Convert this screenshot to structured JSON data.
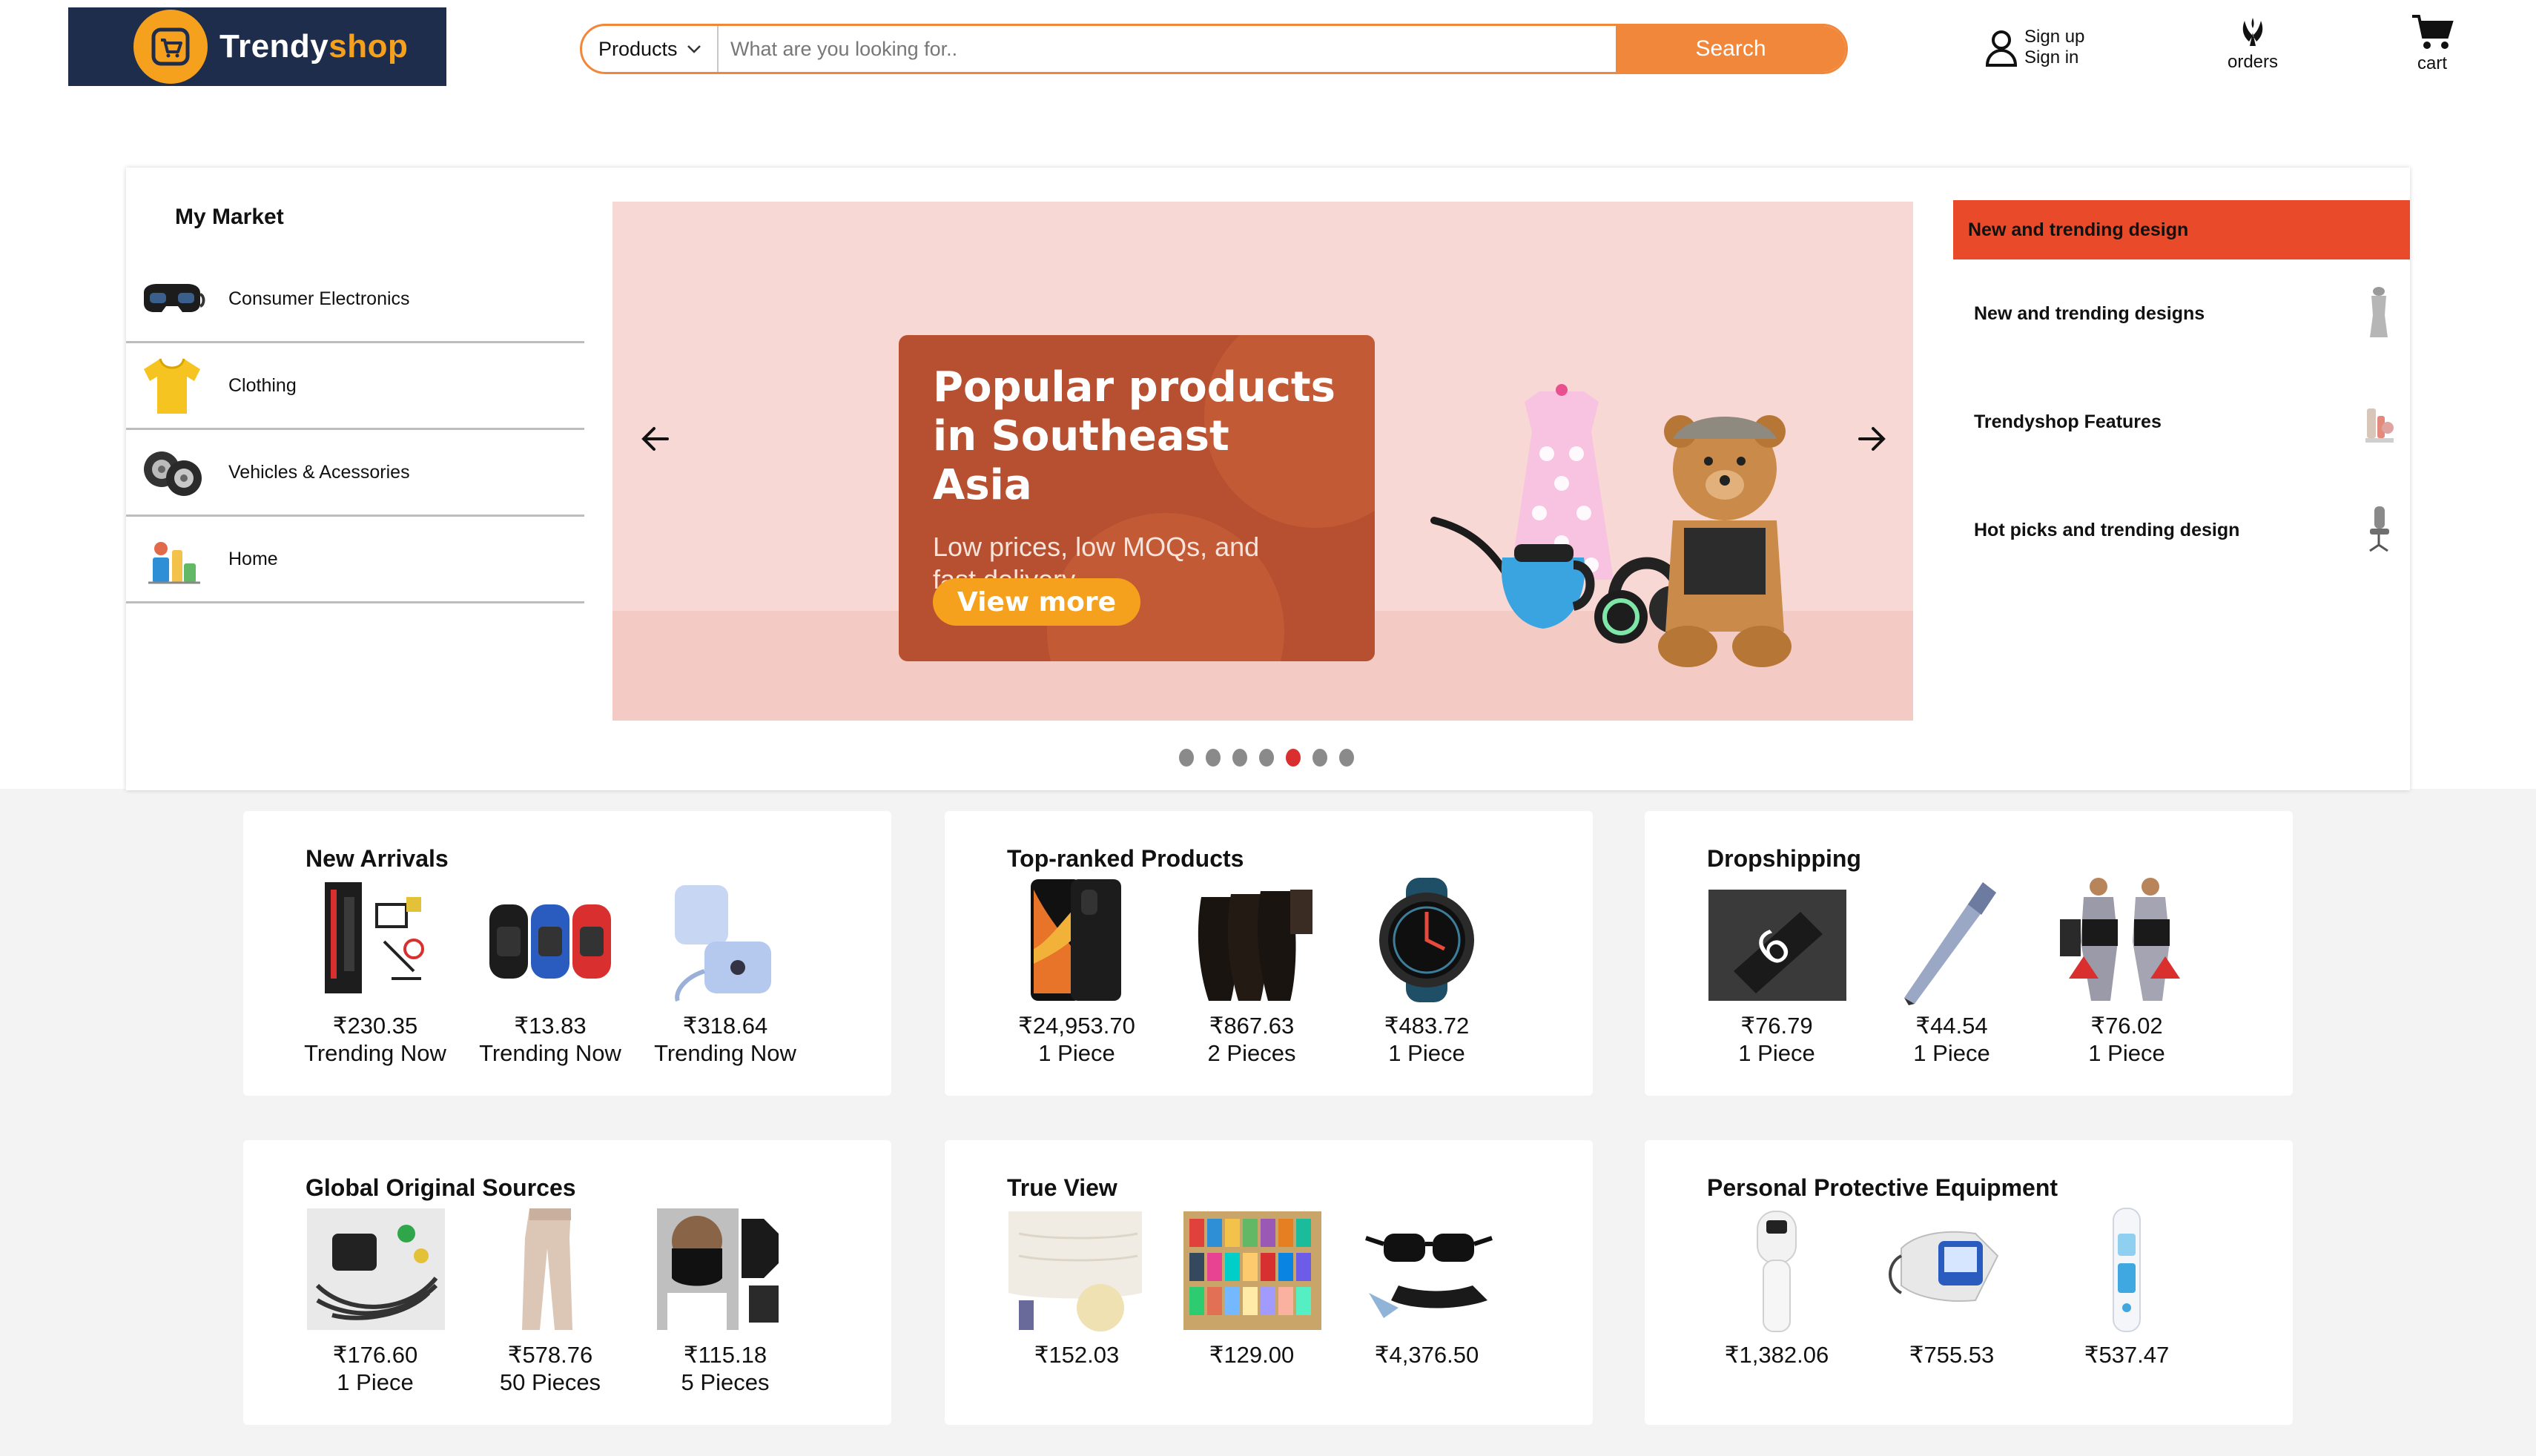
{
  "header": {
    "logo": {
      "brand_main": "Trendy",
      "brand_accent": "shop",
      "icon": "cart-logo-icon"
    },
    "search": {
      "category": "Products",
      "placeholder": "What are you looking for..",
      "button_label": "Search"
    },
    "account": {
      "sign_up": "Sign up",
      "sign_in": "Sign in",
      "icon": "user-icon"
    },
    "orders": {
      "label": "orders",
      "icon": "orders-icon"
    },
    "cart": {
      "label": "cart",
      "icon": "cart-icon"
    }
  },
  "market": {
    "title": "My Market",
    "items": [
      {
        "label": "Consumer Electronics",
        "icon": "vr-headset-icon"
      },
      {
        "label": "Clothing",
        "icon": "tshirt-icon"
      },
      {
        "label": "Vehicles & Acessories",
        "icon": "tire-icon"
      },
      {
        "label": "Home",
        "icon": "home-goods-icon"
      }
    ]
  },
  "banner": {
    "title_line1": "Popular products",
    "title_line2": "in Southeast Asia",
    "subtitle_line1": "Low prices, low MOQs, and",
    "subtitle_line2": "fast delivery",
    "cta": "View more",
    "slide_count": 7,
    "active_slide": 5
  },
  "trending": {
    "header": "New and trending design",
    "items": [
      {
        "label": "New and trending designs",
        "icon": "mannequin-icon"
      },
      {
        "label": "Trendyshop Features",
        "icon": "cosmetics-icon"
      },
      {
        "label": "Hot picks and trending design",
        "icon": "office-chair-icon"
      }
    ]
  },
  "colors": {
    "accent": "#f0873a",
    "logo_bg": "#1f2d4d",
    "logo_accent": "#f6a11d",
    "trend_header": "#e84a2a",
    "dot_active": "#d9302f"
  },
  "sections": [
    {
      "title": "New Arrivals",
      "items": [
        {
          "price": "₹230.35",
          "sub": "Trending Now",
          "icon": "circuit-board-icon"
        },
        {
          "price": "₹13.83",
          "sub": "Trending Now",
          "icon": "smart-band-icon"
        },
        {
          "price": "₹318.64",
          "sub": "Trending Now",
          "icon": "camera-bag-icon"
        }
      ]
    },
    {
      "title": "Top-ranked Products",
      "items": [
        {
          "price": "₹24,953.70",
          "sub": "1 Piece",
          "icon": "smartphone-icon"
        },
        {
          "price": "₹867.63",
          "sub": "2 Pieces",
          "icon": "hair-bundle-icon"
        },
        {
          "price": "₹483.72",
          "sub": "1 Piece",
          "icon": "smartwatch-icon"
        }
      ]
    },
    {
      "title": "Dropshipping",
      "items": [
        {
          "price": "₹76.79",
          "sub": "1 Piece",
          "icon": "band-box-icon"
        },
        {
          "price": "₹44.54",
          "sub": "1 Piece",
          "icon": "stylus-pen-icon"
        },
        {
          "price": "₹76.02",
          "sub": "1 Piece",
          "icon": "waist-trainer-icon"
        }
      ]
    },
    {
      "title": "Global Original Sources",
      "items": [
        {
          "price": "₹176.60",
          "sub": "1 Piece",
          "icon": "cable-kit-icon"
        },
        {
          "price": "₹578.76",
          "sub": "50 Pieces",
          "icon": "leggings-icon"
        },
        {
          "price": "₹115.18",
          "sub": "5 Pieces",
          "icon": "face-mask-icon"
        }
      ]
    },
    {
      "title": "True View",
      "items": [
        {
          "price": "₹152.03",
          "sub": "",
          "icon": "fabric-roll-icon"
        },
        {
          "price": "₹129.00",
          "sub": "",
          "icon": "thread-spools-icon"
        },
        {
          "price": "₹4,376.50",
          "sub": "",
          "icon": "smart-glasses-icon"
        }
      ]
    },
    {
      "title": "Personal Protective Equipment",
      "items": [
        {
          "price": "₹1,382.06",
          "sub": "",
          "icon": "thermometer-gun-icon"
        },
        {
          "price": "₹755.53",
          "sub": "",
          "icon": "blood-pressure-monitor-icon"
        },
        {
          "price": "₹537.47",
          "sub": "",
          "icon": "ear-thermometer-icon"
        }
      ]
    }
  ]
}
